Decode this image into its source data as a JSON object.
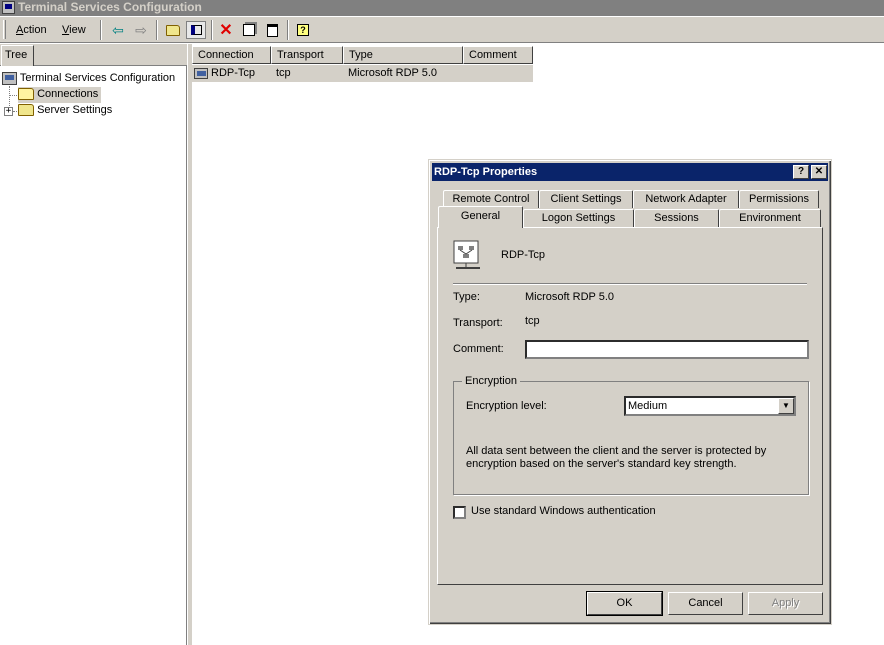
{
  "window": {
    "title": "Terminal Services Configuration"
  },
  "menu": {
    "action": "Action",
    "view": "View"
  },
  "toolbar_icons": [
    "back-arrow-icon",
    "forward-arrow-icon",
    "up-folder-icon",
    "show-hide-tree-icon",
    "delete-icon",
    "properties-icon",
    "export-list-icon",
    "help-icon"
  ],
  "tree": {
    "tab_label": "Tree",
    "root": "Terminal Services Configuration",
    "items": [
      "Connections",
      "Server Settings"
    ]
  },
  "list": {
    "columns": [
      "Connection",
      "Transport",
      "Type",
      "Comment"
    ],
    "rows": [
      {
        "connection": "RDP-Tcp",
        "transport": "tcp",
        "type": "Microsoft RDP 5.0",
        "comment": ""
      }
    ]
  },
  "dialog": {
    "title": "RDP-Tcp Properties",
    "help_button": "?",
    "close_button": "✕",
    "tabs_back": [
      "Remote Control",
      "Client Settings",
      "Network Adapter",
      "Permissions"
    ],
    "tabs_front": [
      "General",
      "Logon Settings",
      "Sessions",
      "Environment"
    ],
    "connection_name": "RDP-Tcp",
    "type_label": "Type:",
    "type_value": "Microsoft RDP 5.0",
    "transport_label": "Transport:",
    "transport_value": "tcp",
    "comment_label": "Comment:",
    "comment_value": "",
    "encryption": {
      "group_label": "Encryption",
      "level_label": "Encryption level:",
      "level_value": "Medium",
      "description": "All data sent between the client and the server is protected by encryption based on the server's standard key strength."
    },
    "checkbox_label": "Use standard Windows authentication",
    "checkbox_checked": false,
    "buttons": {
      "ok": "OK",
      "cancel": "Cancel",
      "apply": "Apply"
    }
  }
}
